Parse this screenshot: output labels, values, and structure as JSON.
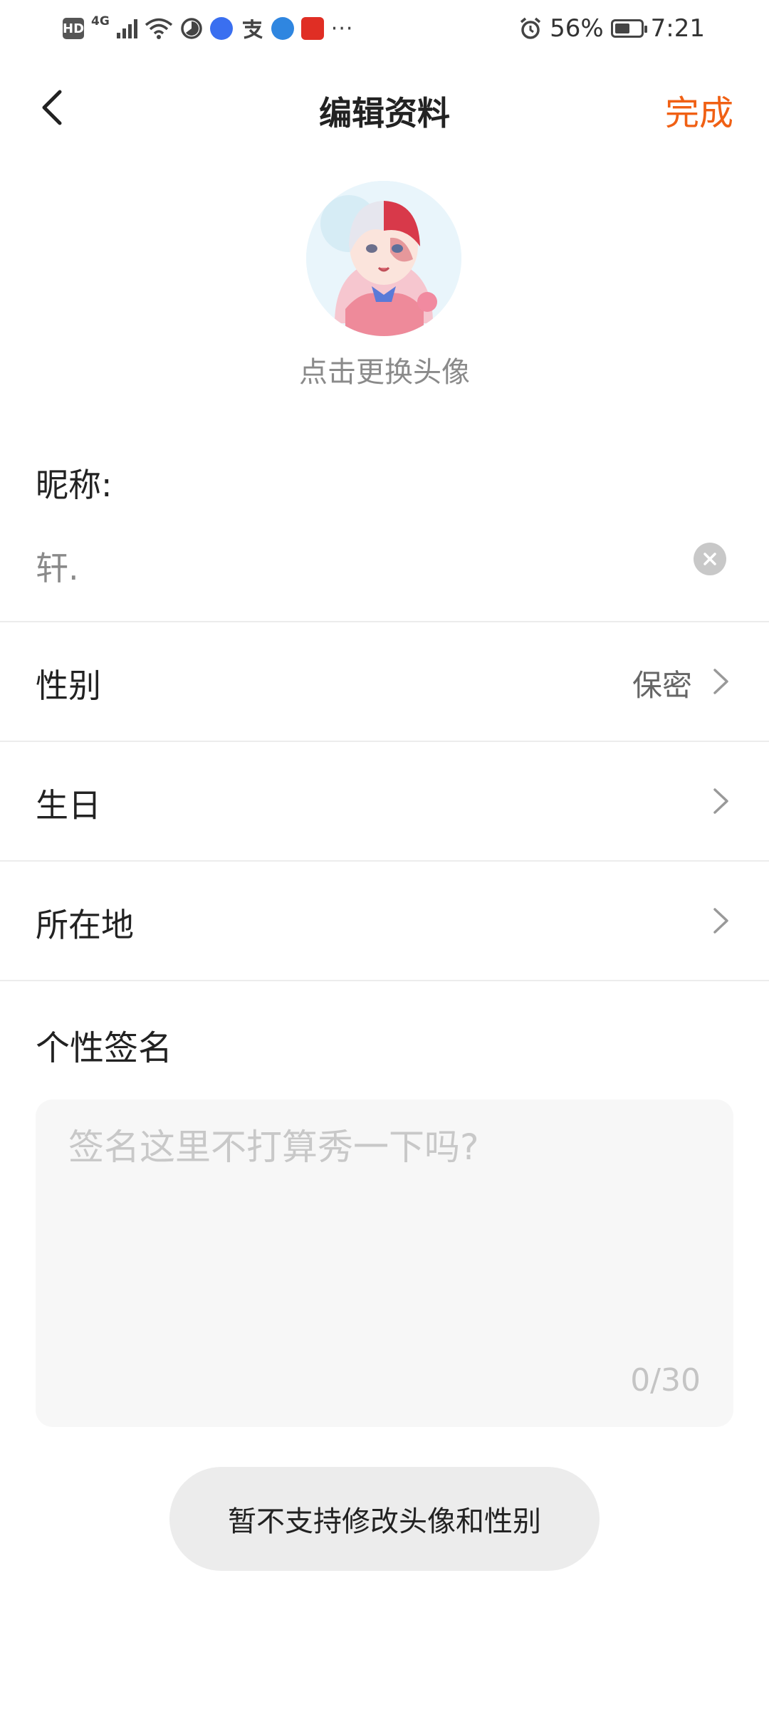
{
  "status_bar": {
    "hd": "HD",
    "network": "4G",
    "icons": [
      "hd-icon",
      "signal-icon",
      "wifi-icon",
      "timer-icon",
      "music-app-icon",
      "alipay-icon",
      "browser-icon",
      "pinduoduo-icon",
      "more-icon"
    ],
    "more": "···",
    "battery_percent": "56%",
    "time": "7:21"
  },
  "nav": {
    "title": "编辑资料",
    "done_label": "完成"
  },
  "avatar": {
    "caption": "点击更换头像"
  },
  "nickname": {
    "label": "昵称:",
    "value": "轩."
  },
  "rows": [
    {
      "label": "性别",
      "value": "保密"
    },
    {
      "label": "生日",
      "value": ""
    },
    {
      "label": "所在地",
      "value": ""
    }
  ],
  "signature": {
    "label": "个性签名",
    "placeholder": "签名这里不打算秀一下吗?",
    "counter": "0/30"
  },
  "toast": {
    "text": "暂不支持修改头像和性别"
  },
  "colors": {
    "accent": "#f06014",
    "divider": "#ececec",
    "input_bg": "#f7f7f7"
  }
}
